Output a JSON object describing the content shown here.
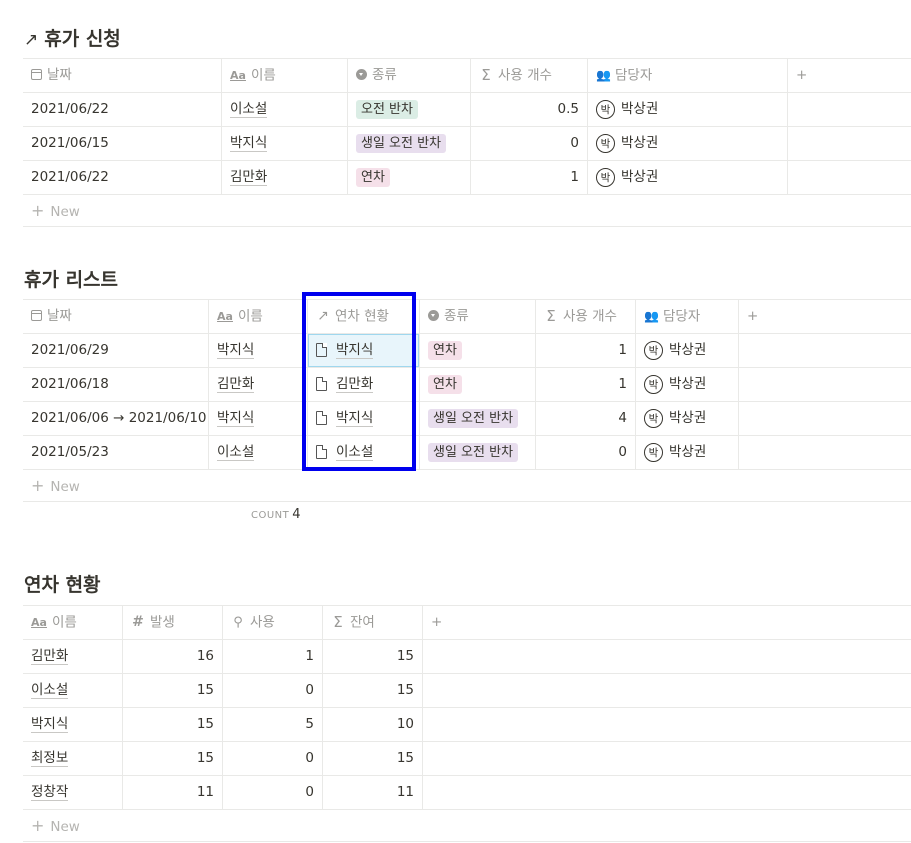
{
  "leave_request": {
    "title": "휴가 신청",
    "headers": {
      "date": "날짜",
      "name": "이름",
      "type": "종류",
      "used": "사용 개수",
      "manager": "담당자"
    },
    "rows": [
      {
        "date": "2021/06/22",
        "name": "이소설",
        "type": "오전 반차",
        "used": "0.5",
        "manager": "박상권"
      },
      {
        "date": "2021/06/15",
        "name": "박지식",
        "type": "생일 오전 반차",
        "used": "0",
        "manager": "박상권"
      },
      {
        "date": "2021/06/22",
        "name": "김만화",
        "type": "연차",
        "used": "1",
        "manager": "박상권"
      }
    ],
    "new_label": "New"
  },
  "leave_list": {
    "title": "휴가 리스트",
    "headers": {
      "date": "날짜",
      "name": "이름",
      "status": "연차 현황",
      "type": "종류",
      "used": "사용 개수",
      "manager": "담당자"
    },
    "rows": [
      {
        "date": "2021/06/29",
        "name": "박지식",
        "status": "박지식",
        "type": "연차",
        "used": "1",
        "manager": "박상권"
      },
      {
        "date": "2021/06/18",
        "name": "김만화",
        "status": "김만화",
        "type": "연차",
        "used": "1",
        "manager": "박상권"
      },
      {
        "date": "2021/06/06 → 2021/06/10",
        "name": "박지식",
        "status": "박지식",
        "type": "생일 오전 반차",
        "used": "4",
        "manager": "박상권"
      },
      {
        "date": "2021/05/23",
        "name": "이소설",
        "status": "이소설",
        "type": "생일 오전 반차",
        "used": "0",
        "manager": "박상권"
      }
    ],
    "new_label": "New",
    "count_label": "COUNT",
    "count_value": "4"
  },
  "leave_status": {
    "title": "연차 현황",
    "headers": {
      "name": "이름",
      "issued": "발생",
      "used": "사용",
      "remaining": "잔여"
    },
    "rows": [
      {
        "name": "김만화",
        "issued": "16",
        "used": "1",
        "remaining": "15"
      },
      {
        "name": "이소설",
        "issued": "15",
        "used": "0",
        "remaining": "15"
      },
      {
        "name": "박지식",
        "issued": "15",
        "used": "5",
        "remaining": "10"
      },
      {
        "name": "최정보",
        "issued": "15",
        "used": "0",
        "remaining": "15"
      },
      {
        "name": "정창작",
        "issued": "11",
        "used": "0",
        "remaining": "11"
      }
    ],
    "new_label": "New"
  },
  "avatar_initial": "박",
  "icons": {
    "arrow": "↗",
    "sigma": "Σ",
    "aa": "Aa",
    "hash": "#",
    "search": "🔍",
    "plus": "+"
  },
  "colors": {
    "highlight": "#0000ee",
    "tag_green": "#dbede5",
    "tag_purple": "#e8deee",
    "tag_pink": "#f5e0e9"
  }
}
